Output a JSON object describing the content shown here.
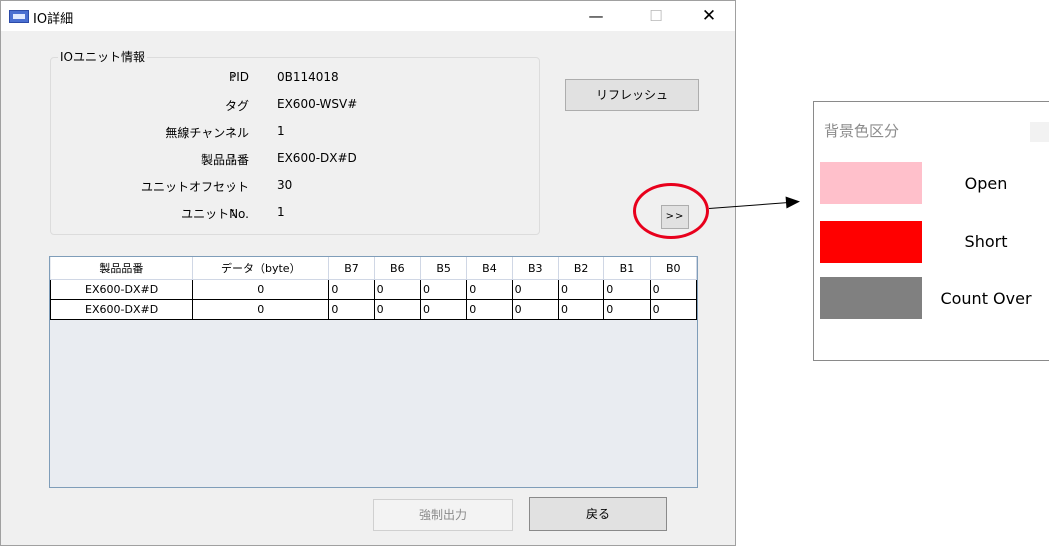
{
  "window": {
    "title": "IO詳細",
    "minimize": "—",
    "maximize": "☐",
    "close": "✕"
  },
  "unit_info": {
    "group_title": "IOユニット情報",
    "rows": [
      {
        "label": "PID",
        "colon": ":",
        "value": "0B114018"
      },
      {
        "label": "タグ",
        "colon": ":",
        "value": "EX600-WSV#"
      },
      {
        "label": "無線チャンネル",
        "colon": ":",
        "value": "1"
      },
      {
        "label": "製品品番",
        "colon": ":",
        "value": "EX600-DX#D"
      },
      {
        "label": "ユニットオフセット",
        "colon": ":",
        "value": "30"
      },
      {
        "label": "ユニットNo.",
        "colon": ":",
        "value": "1"
      }
    ]
  },
  "buttons": {
    "refresh": "リフレッシュ",
    "expand": ">>",
    "force_output": "強制出力",
    "back": "戻る"
  },
  "table": {
    "headers": [
      "製品品番",
      "データ（byte）",
      "B7",
      "B6",
      "B5",
      "B4",
      "B3",
      "B2",
      "B1",
      "B0"
    ],
    "rows": [
      [
        "EX600-DX#D",
        "0",
        "0",
        "0",
        "0",
        "0",
        "0",
        "0",
        "0",
        "0"
      ],
      [
        "EX600-DX#D",
        "0",
        "0",
        "0",
        "0",
        "0",
        "0",
        "0",
        "0",
        "0"
      ]
    ]
  },
  "legend": {
    "title": "背景色区分",
    "items": [
      {
        "label": "Open",
        "color": "#ffc0cb"
      },
      {
        "label": "Short",
        "color": "#ff0000"
      },
      {
        "label": "Count Over",
        "color": "#808080"
      }
    ]
  },
  "colors": {
    "highlight_circle": "#e8001c",
    "grid_background": "#e9ecf1"
  }
}
